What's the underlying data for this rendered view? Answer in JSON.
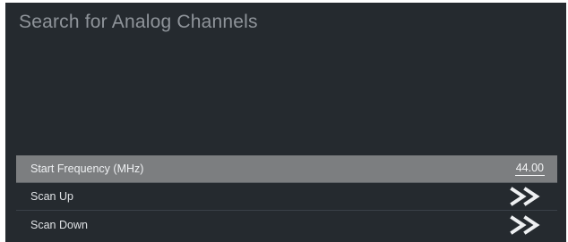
{
  "screen": {
    "title": "Search for Analog Channels"
  },
  "menu": {
    "items": [
      {
        "label": "Start Frequency (MHz)",
        "value": "44.00",
        "selected": true
      },
      {
        "label": "Scan Up",
        "icon": "double-chevron-right-icon"
      },
      {
        "label": "Scan Down",
        "icon": "double-chevron-right-icon"
      }
    ]
  },
  "colors": {
    "background": "#252a2f",
    "title_text": "#8f949a",
    "selected_row": "#7c7e80",
    "row_text": "#dfe2e5"
  }
}
